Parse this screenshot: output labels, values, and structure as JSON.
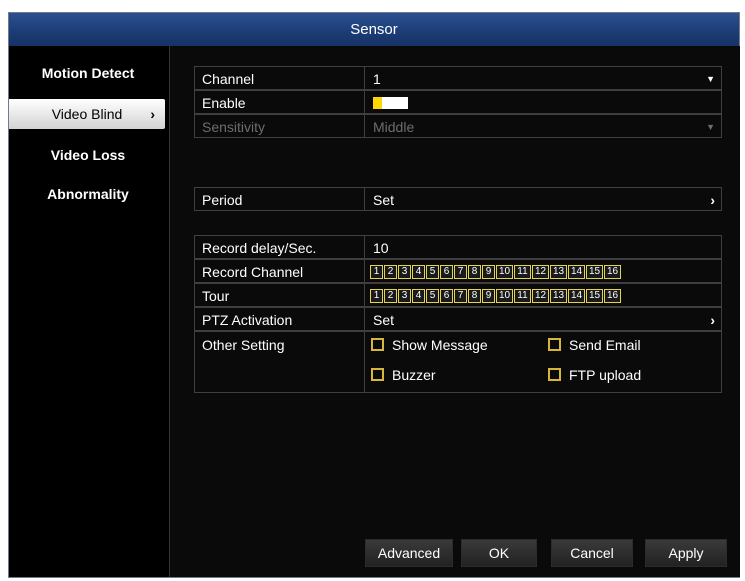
{
  "window": {
    "title": "Sensor"
  },
  "sidebar": {
    "items": [
      {
        "label": "Motion Detect"
      },
      {
        "label": "Video Blind",
        "chevron": "›"
      },
      {
        "label": "Video Loss"
      },
      {
        "label": "Abnormality"
      }
    ]
  },
  "form": {
    "channel": {
      "label": "Channel",
      "value": "1"
    },
    "enable": {
      "label": "Enable"
    },
    "sensitivity": {
      "label": "Sensitivity",
      "value": "Middle"
    },
    "period": {
      "label": "Period",
      "value": "Set"
    },
    "record_delay": {
      "label": "Record delay/Sec.",
      "value": "10"
    },
    "record_channel": {
      "label": "Record Channel",
      "channels": [
        "1",
        "2",
        "3",
        "4",
        "5",
        "6",
        "7",
        "8",
        "9",
        "10",
        "11",
        "12",
        "13",
        "14",
        "15",
        "16"
      ]
    },
    "tour": {
      "label": "Tour",
      "channels": [
        "1",
        "2",
        "3",
        "4",
        "5",
        "6",
        "7",
        "8",
        "9",
        "10",
        "11",
        "12",
        "13",
        "14",
        "15",
        "16"
      ]
    },
    "ptz": {
      "label": "PTZ Activation",
      "value": "Set"
    },
    "other": {
      "label": "Other Setting",
      "options": {
        "show_message": "Show Message",
        "send_email": "Send Email",
        "buzzer": "Buzzer",
        "ftp_upload": "FTP upload"
      }
    }
  },
  "buttons": {
    "advanced": "Advanced",
    "ok": "OK",
    "cancel": "Cancel",
    "apply": "Apply"
  },
  "colors": {
    "title_bar": "#1c3d78",
    "toggle_on": "#ffd700",
    "checkbox": "#d6b73c"
  }
}
